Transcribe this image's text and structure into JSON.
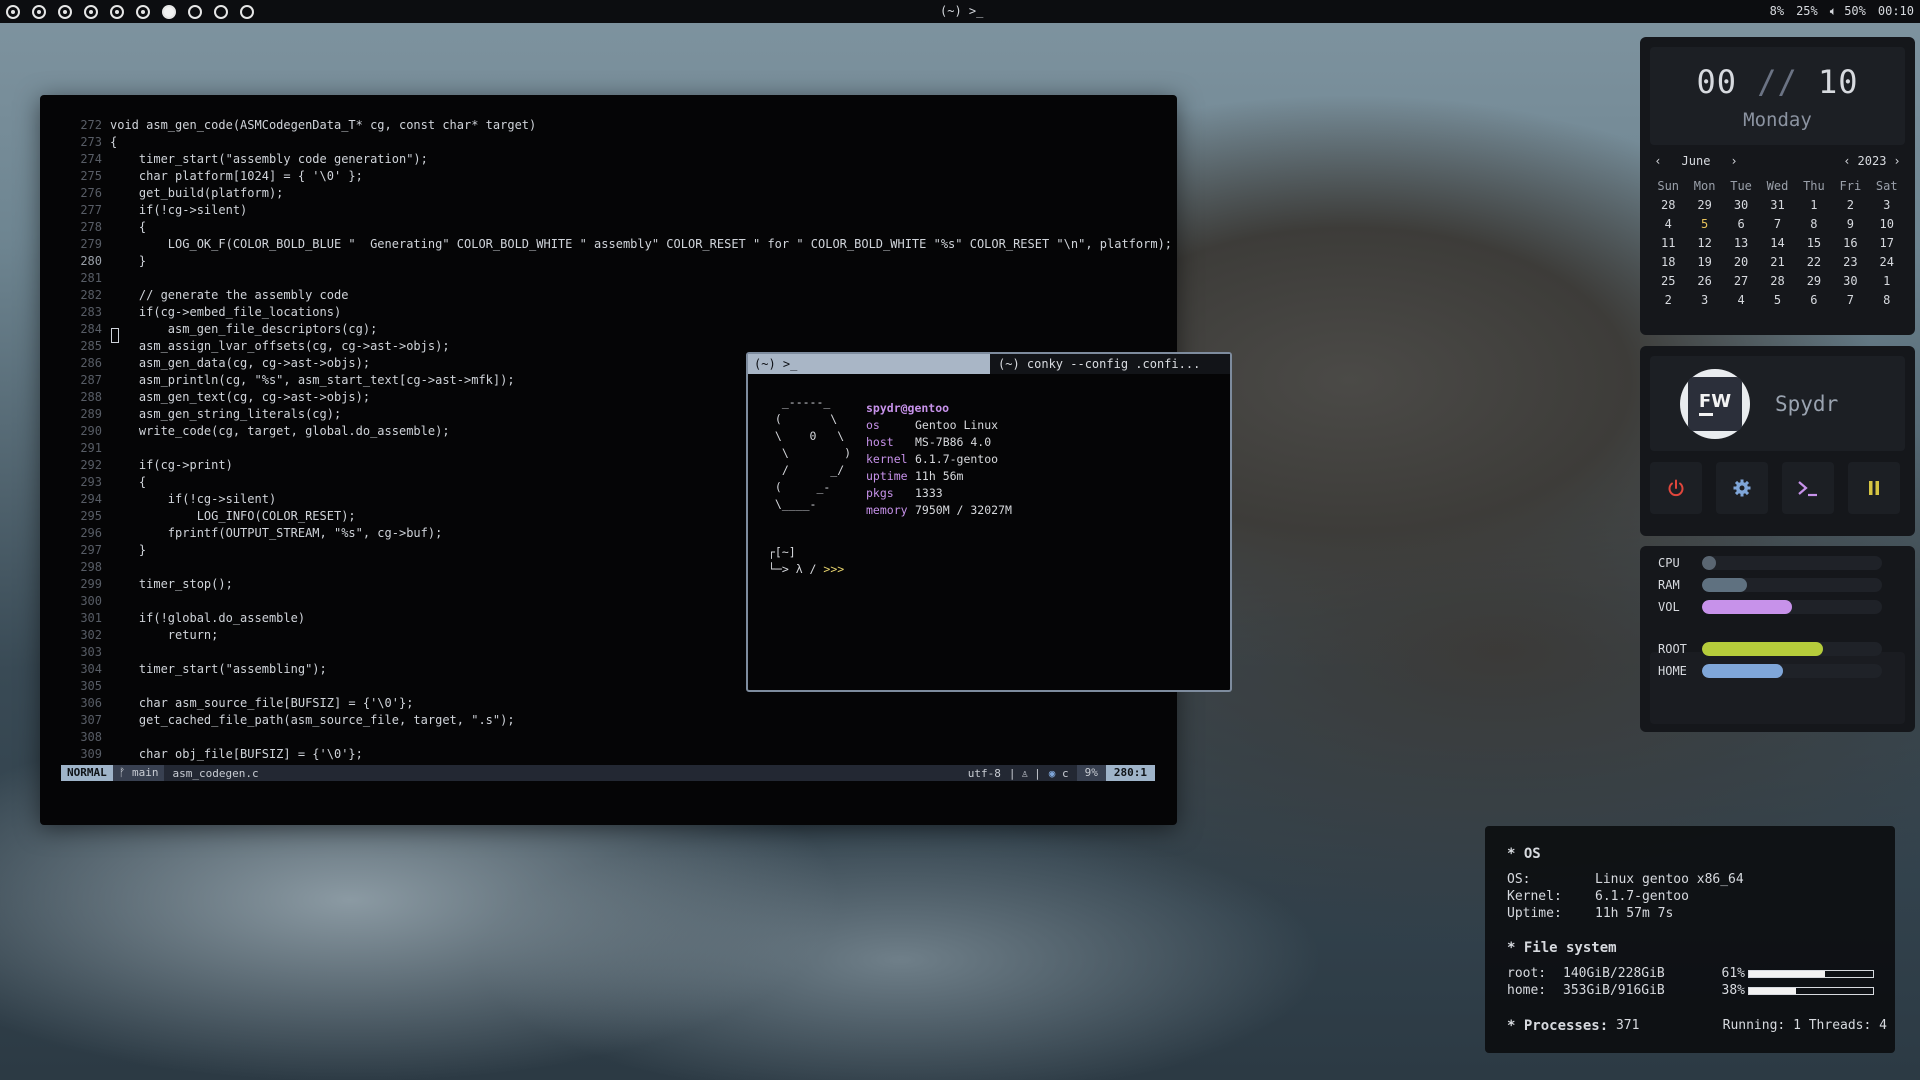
{
  "topbar": {
    "workspaces": [
      {
        "state": "occupied"
      },
      {
        "state": "occupied"
      },
      {
        "state": "occupied"
      },
      {
        "state": "occupied"
      },
      {
        "state": "occupied"
      },
      {
        "state": "occupied"
      },
      {
        "state": "active"
      },
      {
        "state": "empty"
      },
      {
        "state": "empty"
      },
      {
        "state": "empty"
      }
    ],
    "window_title": "(~) >_",
    "status": {
      "brightness": "8%",
      "battery": "25%",
      "volume": "50%",
      "volume_icon": "speaker-icon",
      "time": "00:10"
    }
  },
  "editor": {
    "lines": [
      {
        "n": "272",
        "t": "void asm_gen_code(ASMCodegenData_T* cg, const char* target)"
      },
      {
        "n": "273",
        "t": "{"
      },
      {
        "n": "274",
        "t": "    timer_start(\"assembly code generation\");"
      },
      {
        "n": "275",
        "t": "    char platform[1024] = { '\\0' };"
      },
      {
        "n": "276",
        "t": "    get_build(platform);"
      },
      {
        "n": "277",
        "t": "    if(!cg->silent)"
      },
      {
        "n": "278",
        "t": "    {"
      },
      {
        "n": "279",
        "t": "        LOG_OK_F(COLOR_BOLD_BLUE \"  Generating\" COLOR_BOLD_WHITE \" assembly\" COLOR_RESET \" for \" COLOR_BOLD_WHITE \"%s\" COLOR_RESET \"\\n\", platform);"
      },
      {
        "n": "280",
        "t": "    }"
      },
      {
        "n": "281",
        "t": ""
      },
      {
        "n": "282",
        "t": "    // generate the assembly code"
      },
      {
        "n": "283",
        "t": "    if(cg->embed_file_locations)"
      },
      {
        "n": "284",
        "t": "        asm_gen_file_descriptors(cg);"
      },
      {
        "n": "285",
        "t": "    asm_assign_lvar_offsets(cg, cg->ast->objs);"
      },
      {
        "n": "286",
        "t": "    asm_gen_data(cg, cg->ast->objs);"
      },
      {
        "n": "287",
        "t": "    asm_println(cg, \"%s\", asm_start_text[cg->ast->mfk]);"
      },
      {
        "n": "288",
        "t": "    asm_gen_text(cg, cg->ast->objs);"
      },
      {
        "n": "289",
        "t": "    asm_gen_string_literals(cg);"
      },
      {
        "n": "290",
        "t": "    write_code(cg, target, global.do_assemble);"
      },
      {
        "n": "291",
        "t": ""
      },
      {
        "n": "292",
        "t": "    if(cg->print)"
      },
      {
        "n": "293",
        "t": "    {"
      },
      {
        "n": "294",
        "t": "        if(!cg->silent)"
      },
      {
        "n": "295",
        "t": "            LOG_INFO(COLOR_RESET);"
      },
      {
        "n": "296",
        "t": "        fprintf(OUTPUT_STREAM, \"%s\", cg->buf);"
      },
      {
        "n": "297",
        "t": "    }"
      },
      {
        "n": "298",
        "t": ""
      },
      {
        "n": "299",
        "t": "    timer_stop();"
      },
      {
        "n": "300",
        "t": ""
      },
      {
        "n": "301",
        "t": "    if(!global.do_assemble)"
      },
      {
        "n": "302",
        "t": "        return;"
      },
      {
        "n": "303",
        "t": ""
      },
      {
        "n": "304",
        "t": "    timer_start(\"assembling\");"
      },
      {
        "n": "305",
        "t": ""
      },
      {
        "n": "306",
        "t": "    char asm_source_file[BUFSIZ] = {'\\0'};"
      },
      {
        "n": "307",
        "t": "    get_cached_file_path(asm_source_file, target, \".s\");"
      },
      {
        "n": "308",
        "t": ""
      },
      {
        "n": "309",
        "t": "    char obj_file[BUFSIZ] = {'\\0'};"
      }
    ],
    "status": {
      "mode": "NORMAL",
      "branch": "ᚠ main",
      "file": "asm_codegen.c",
      "encoding": "utf-8",
      "separator": "|",
      "ft": "c",
      "percent": "9%",
      "position": "280:1"
    }
  },
  "terminal": {
    "tabs": [
      "(~) >_",
      "(~) conky --config .confi..."
    ],
    "ascii": "  _-----_\n (       \\\n \\    0   \\\n  \\        )\n  /      _/\n (     _-\n \\____-",
    "user": "spydr@gentoo",
    "fetch": [
      {
        "key": "os",
        "value": "Gentoo Linux"
      },
      {
        "key": "host",
        "value": "MS-7B86 4.0"
      },
      {
        "key": "kernel",
        "value": "6.1.7-gentoo"
      },
      {
        "key": "uptime",
        "value": "11h 56m"
      },
      {
        "key": "pkgs",
        "value": "1333"
      },
      {
        "key": "memory",
        "value": "7950M / 32027M"
      }
    ],
    "prompt_line1": "┌[~]",
    "prompt_line2": "└─> λ / ",
    "prompt_ps": ">>>"
  },
  "clock": {
    "hour": "00",
    "sep": "//",
    "minute": "10",
    "day": "Monday"
  },
  "calendar": {
    "prev": "‹",
    "next": "›",
    "month": "June",
    "year": "2023",
    "weekdays": [
      "Sun",
      "Mon",
      "Tue",
      "Wed",
      "Thu",
      "Fri",
      "Sat"
    ],
    "days": [
      "28",
      "29",
      "30",
      "31",
      "1",
      "2",
      "3",
      "4",
      "5",
      "6",
      "7",
      "8",
      "9",
      "10",
      "11",
      "12",
      "13",
      "14",
      "15",
      "16",
      "17",
      "18",
      "19",
      "20",
      "21",
      "22",
      "23",
      "24",
      "25",
      "26",
      "27",
      "28",
      "29",
      "30",
      "1",
      "2",
      "3",
      "4",
      "5",
      "6",
      "7",
      "8"
    ],
    "today_index": 8
  },
  "profile": {
    "avatar_text": "FW",
    "name": "Spydr"
  },
  "buttons": [
    {
      "icon": "power-icon",
      "color": "#e0463c"
    },
    {
      "icon": "gear-icon",
      "color": "#7fa6d9"
    },
    {
      "icon": "terminal-icon",
      "color": "#c792ea"
    },
    {
      "icon": "pause-icon",
      "color": "#d6c542"
    }
  ],
  "stats": [
    {
      "label": "CPU",
      "value": 0.07,
      "color": "#5a6672"
    },
    {
      "label": "RAM",
      "value": 0.25,
      "color": "#5f7180"
    },
    {
      "label": "VOL",
      "value": 0.5,
      "color": "#c792ea"
    },
    {
      "label": "ROOT",
      "value": 0.67,
      "color": "#b5cc3b"
    },
    {
      "label": "HOME",
      "value": 0.45,
      "color": "#7fa6d9"
    }
  ],
  "conky": {
    "os_head": "* OS",
    "os_rows": [
      {
        "key": "OS:",
        "value": "Linux gentoo x86_64"
      },
      {
        "key": "Kernel:",
        "value": "6.1.7-gentoo"
      },
      {
        "key": "Uptime:",
        "value": "11h 57m 7s"
      }
    ],
    "fs_head": "* File system",
    "fs_rows": [
      {
        "key": "root:",
        "value": "140GiB/228GiB",
        "pct": "61%",
        "frac": 0.61
      },
      {
        "key": "home:",
        "value": "353GiB/916GiB",
        "pct": "38%",
        "frac": 0.38
      }
    ],
    "proc_label": "* Processes:",
    "proc_count": "371",
    "running": "Running: 1 Threads: 4"
  }
}
